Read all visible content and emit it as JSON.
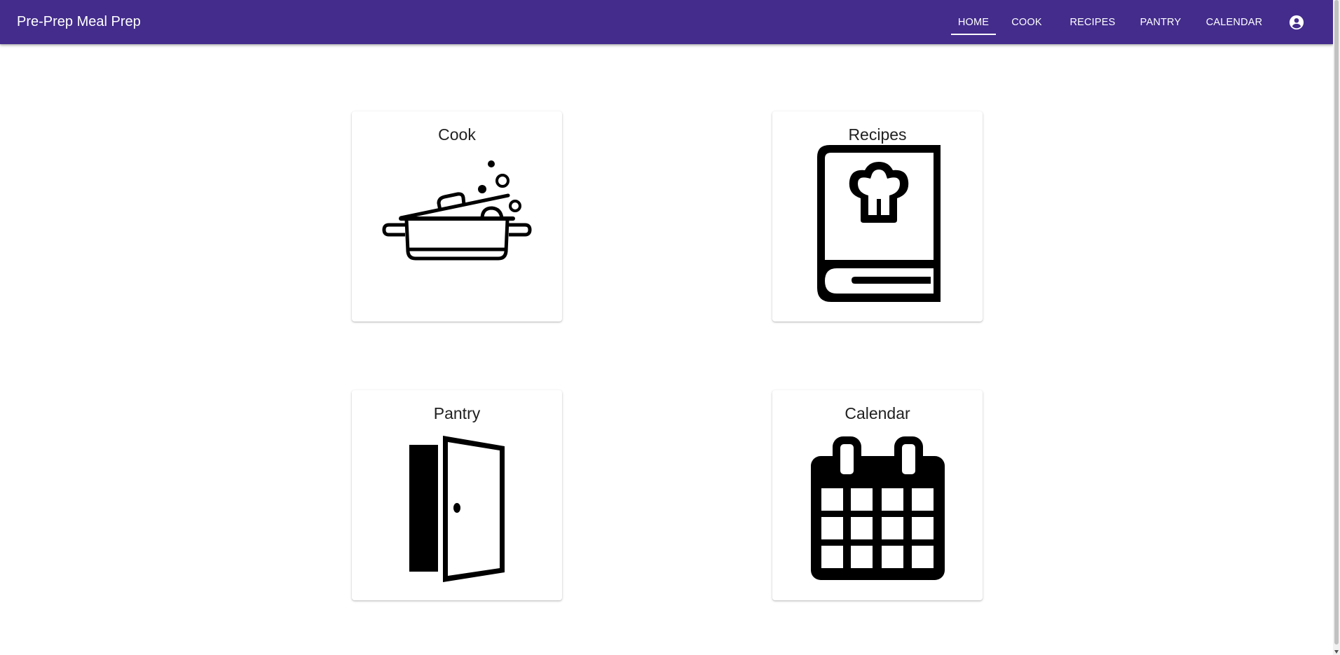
{
  "header": {
    "brand": "Pre-Prep Meal Prep",
    "background_color": "#432c8c",
    "nav": [
      {
        "label": "HOME",
        "active": true
      },
      {
        "label": "COOK",
        "active": false
      },
      {
        "label": "RECIPES",
        "active": false
      },
      {
        "label": "PANTRY",
        "active": false
      },
      {
        "label": "CALENDAR",
        "active": false
      }
    ],
    "account_icon": "account-circle-icon"
  },
  "cards": [
    {
      "title": "Cook",
      "icon": "cooking-pot-icon"
    },
    {
      "title": "Recipes",
      "icon": "recipe-book-icon"
    },
    {
      "title": "Pantry",
      "icon": "open-door-icon"
    },
    {
      "title": "Calendar",
      "icon": "calendar-icon"
    }
  ]
}
